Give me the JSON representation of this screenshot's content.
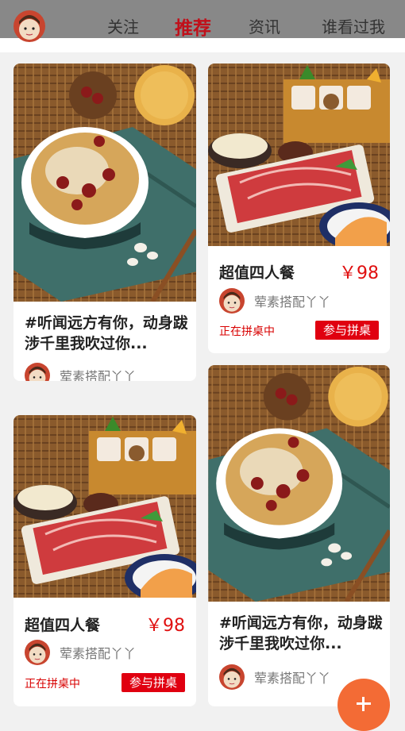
{
  "nav": {
    "items": [
      {
        "label": "关注",
        "active": false
      },
      {
        "label": "推荐",
        "active": true
      },
      {
        "label": "资讯",
        "active": false
      },
      {
        "label": "谁看过我",
        "active": false
      }
    ]
  },
  "colors": {
    "accent_red": "#e00010",
    "nav_active": "#c0101a",
    "fab": "#f36b35"
  },
  "cards": {
    "c1": {
      "title": "#听闻远方有你，动身跋涉千里我吹过你...",
      "author": "荤素搭配丫丫",
      "image": "dessert-soup"
    },
    "c2": {
      "title": "超值四人餐",
      "price": "￥98",
      "author": "荤素搭配丫丫",
      "status": "正在拼桌中",
      "button": "参与拼桌",
      "image": "hotpot-set"
    },
    "c3": {
      "title": "超值四人餐",
      "price": "￥98",
      "author": "荤素搭配丫丫",
      "status": "正在拼桌中",
      "button": "参与拼桌",
      "image": "hotpot-set"
    },
    "c4": {
      "title": "#听闻远方有你，动身跋涉千里我吹过你...",
      "author": "荤素搭配丫丫",
      "image": "dessert-soup"
    }
  },
  "fab": {
    "icon": "plus-icon"
  }
}
